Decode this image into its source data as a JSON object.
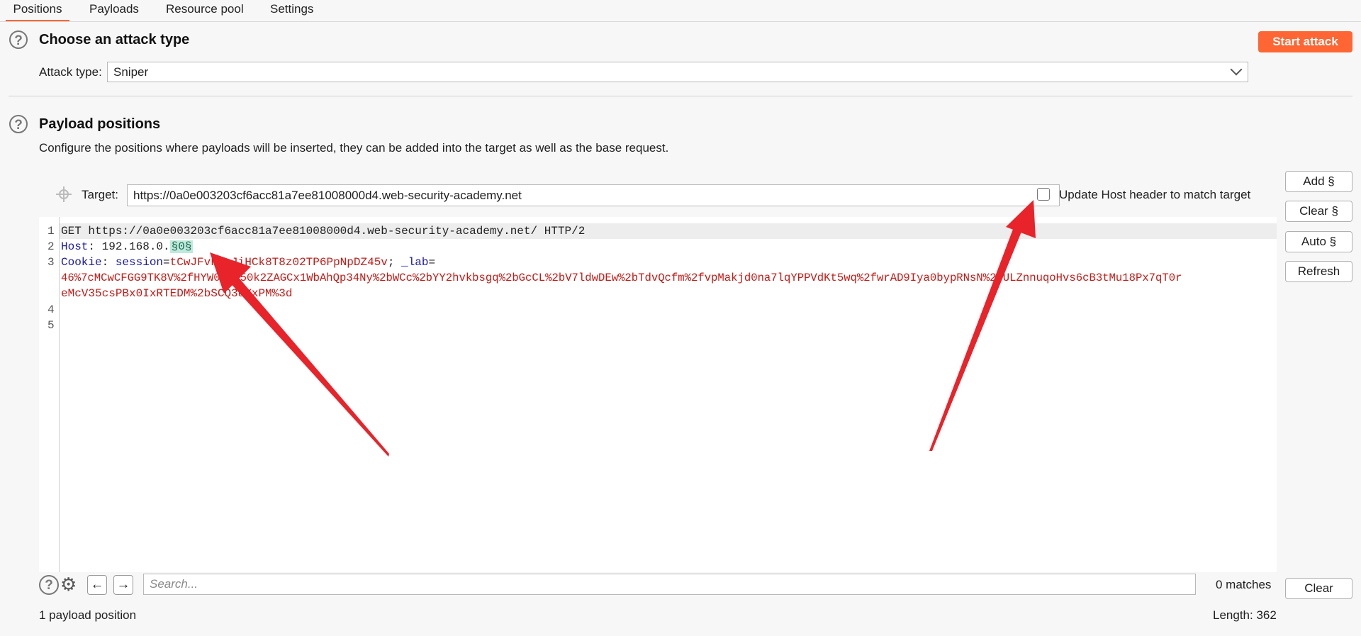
{
  "tabs": [
    {
      "label": "Positions",
      "active": true
    },
    {
      "label": "Payloads",
      "active": false
    },
    {
      "label": "Resource pool",
      "active": false
    },
    {
      "label": "Settings",
      "active": false
    }
  ],
  "attack_type_section": {
    "title": "Choose an attack type",
    "start_button": "Start attack",
    "attack_type_label": "Attack type:",
    "attack_type_value": "Sniper"
  },
  "payload_positions": {
    "title": "Payload positions",
    "description": "Configure the positions where payloads will be inserted, they can be added into the target as well as the base request.",
    "target_label": "Target:",
    "target_value": "https://0a0e003203cf6acc81a7ee81008000d4.web-security-academy.net",
    "update_host_label": "Update Host header to match target",
    "update_host_checked": false
  },
  "editor": {
    "line_numbers": [
      "1",
      "2",
      "3",
      "",
      "",
      "4",
      "5"
    ],
    "line1": "GET https://0a0e003203cf6acc81a7ee81008000d4.web-security-academy.net/ HTTP/2",
    "line2_key": "Host",
    "line2_sep": ": 192.168.0.",
    "line2_marker": "§0§",
    "line3_key": "Cookie",
    "line3_sep1": ": ",
    "line3_session_key": "session",
    "line3_eq": "=",
    "line3_session_val": "tCwJFvFeoJiHCk8T8z02TP6PpNpDZ45v",
    "line3_semi": "; ",
    "line3_lab_key": "_lab",
    "line3_eq2": "=",
    "line3_cont1": "46%7cMCwCFGG9TK8V%2fHYW0xUf50k2ZAGCx1WbAhQp34Ny%2bWCc%2bYY2hvkbsgq%2bGcCL%2bV7ldwDEw%2bTdvQcfm%2fvpMakjd0na7lqYPPVdKt5wq%2fwrAD9Iya0bypRNsN%2fULZnnuqoHvs6cB3tMu18Px7qT0r",
    "line3_cont2": "eMcV35csPBx0IxRTEDM%2bSCQ3uYxPM%3d"
  },
  "side_buttons": {
    "add": "Add §",
    "clear": "Clear §",
    "auto": "Auto §",
    "refresh": "Refresh"
  },
  "search_bar": {
    "placeholder": "Search...",
    "matches": "0 matches",
    "clear_button": "Clear"
  },
  "footer": {
    "positions_count": "1 payload position",
    "length": "Length: 362"
  },
  "icons": {
    "help": "?",
    "settings": "⚙",
    "back": "←",
    "forward": "→"
  },
  "colors": {
    "accent": "#ff6633",
    "annotation_arrow": "#e8232a",
    "header_key": "#1a1aa6",
    "header_value": "#c41a16",
    "marker_bg": "#bfe9dc"
  }
}
